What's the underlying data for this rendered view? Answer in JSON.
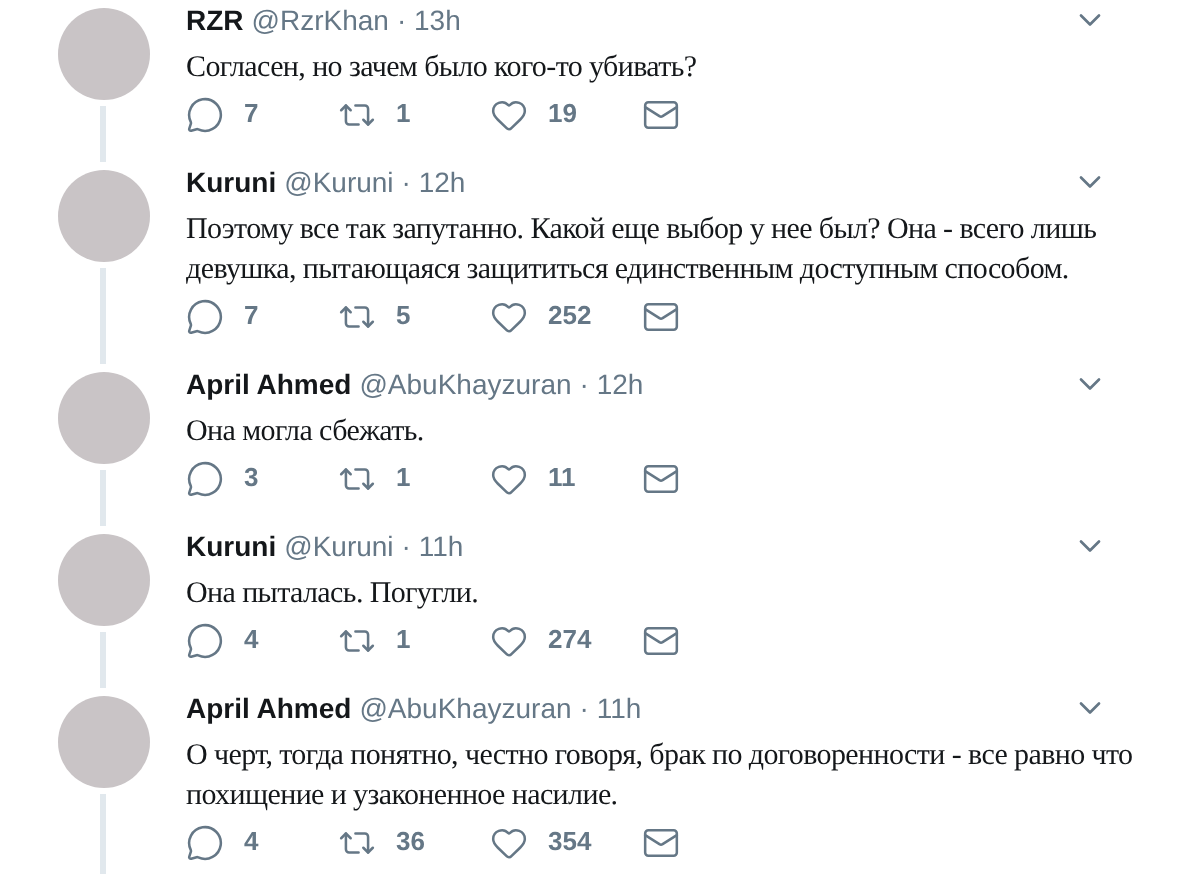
{
  "tweets": [
    {
      "name": "RZR",
      "handle": "@RzrKhan",
      "time": "· 13h",
      "text": "Согласен, но зачем было кого-то убивать?",
      "replies": "7",
      "retweets": "1",
      "likes": "19"
    },
    {
      "name": "Kuruni",
      "handle": "@Kuruni",
      "time": "· 12h",
      "text": "Поэтому все так запутанно. Какой еще выбор у нее был? Она - всего лишь девушка, пытающаяся защититься единственным доступным способом.",
      "replies": "7",
      "retweets": "5",
      "likes": "252"
    },
    {
      "name": "April Ahmed",
      "handle": "@AbuKhayzuran",
      "time": "· 12h",
      "text": "Она могла сбежать.",
      "replies": "3",
      "retweets": "1",
      "likes": "11"
    },
    {
      "name": "Kuruni",
      "handle": "@Kuruni",
      "time": "· 11h",
      "text": "Она пыталась. Погугли.",
      "replies": "4",
      "retweets": "1",
      "likes": "274"
    },
    {
      "name": "April Ahmed",
      "handle": "@AbuKhayzuran",
      "time": "· 11h",
      "text": "О черт, тогда понятно, честно говоря, брак по договоренности - все равно что похищение и узаконенное насилие.",
      "replies": "4",
      "retweets": "36",
      "likes": "354"
    }
  ]
}
